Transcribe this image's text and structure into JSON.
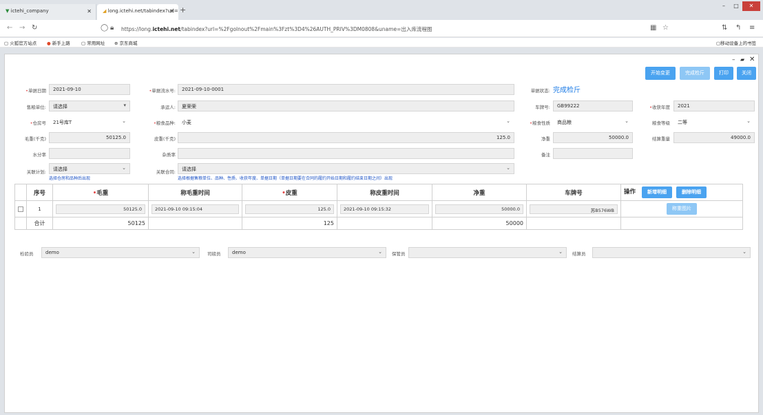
{
  "browser": {
    "tabs": [
      {
        "label": "ictehi_company"
      },
      {
        "label": "long.ictehi.net/tabindex?url="
      }
    ],
    "url_prefix": "https://long.",
    "url_domain": "ictehi.net",
    "url_rest": "/tabindex?url=%2Fgolnout%2Fmain%3Fzt%3D4%26AUTH_PRIV%3DM0808&uname=出入库流程图",
    "bookmarks": [
      "火狐官方站点",
      "新手上路",
      "常用网址",
      "京东商城"
    ],
    "mobile_bookmarks": "移动设备上的书签"
  },
  "toolbar": {
    "start_change": "开始变更",
    "finish_check": "完成检斤",
    "print": "打印",
    "close": "关闭"
  },
  "form": {
    "doc_date_label": "单据日期",
    "doc_date": "2021-09-10",
    "doc_no_label": "单据流水号:",
    "doc_no": "2021-09-10-0001",
    "doc_status_label": "单据状态:",
    "doc_status": "完成检斤",
    "sale_unit_label": "售粮单位:",
    "sale_unit": "请选择",
    "carrier_label": "承运人:",
    "carrier": "夏荣荣",
    "plate_label": "车牌号:",
    "plate": "GB99222",
    "harvest_year_label": "收获年度",
    "harvest_year": "2021",
    "warehouse_label": "仓房号",
    "warehouse": "21号库T",
    "grain_type_label": "粮食品种:",
    "grain_type": "小麦",
    "grain_nature_label": "粮食性质",
    "grain_nature": "商品粮",
    "grain_grade_label": "粮食等级",
    "grain_grade": "二等",
    "gross_label": "毛重(千克)",
    "gross": "50125.0",
    "tare_label": "皮重(千克)",
    "tare": "125.0",
    "net_label": "净重",
    "net": "50000.0",
    "settle_label": "结算重量",
    "settle": "49000.0",
    "moisture_label": "水分率",
    "impurity_label": "杂质率",
    "remark_label": "备注",
    "plan_label": "关联计划:",
    "plan": "请选择",
    "plan_hint": "选择仓房和品种后出现",
    "contract_label": "关联合同:",
    "contract": "请选择",
    "contract_hint": "选择根据售粮单位、品种、性质、收获年度、单据日期（单据日期要在合同的履约开始日期和履约结束日期之间）出现"
  },
  "table": {
    "headers": {
      "seq": "序号",
      "gross": "毛重",
      "gross_time": "称毛重时间",
      "tare": "皮重",
      "tare_time": "称皮重时间",
      "net": "净重",
      "plate": "车牌号",
      "op": "操作"
    },
    "add_btn": "新增明细",
    "del_btn": "删除明细",
    "row": {
      "seq": "1",
      "gross": "50125.0",
      "gross_time": "2021-09-10 09:15:04",
      "tare": "125.0",
      "tare_time": "2021-09-10 09:15:32",
      "net": "50000.0",
      "plate": "苏B576WB",
      "weigh_btn": "称重图片"
    },
    "total": {
      "label": "合计",
      "gross": "50125",
      "tare": "125",
      "net": "50000"
    }
  },
  "footer": {
    "inspector_label": "检验员",
    "inspector": "demo",
    "weigher_label": "司磅员",
    "weigher": "demo",
    "keeper_label": "保管员",
    "keeper": "",
    "settler_label": "结算员",
    "settler": ""
  }
}
